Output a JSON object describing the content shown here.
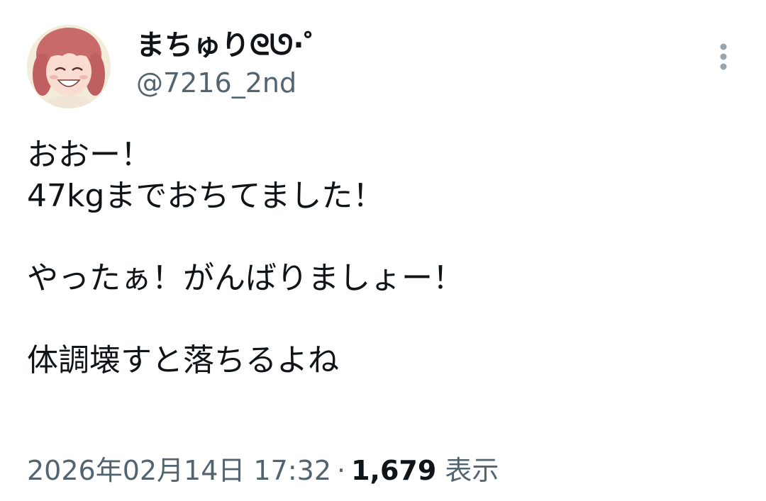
{
  "author": {
    "display_name": "まちゅり",
    "display_name_suffix": "ᘓᘎ·゜",
    "handle": "@7216_2nd",
    "avatar_icon": "user-avatar-anime-portrait"
  },
  "more_icon": "more-options-vertical-dots-icon",
  "body": {
    "lines": [
      "おおー！",
      "47kgまでおちてました！",
      "",
      "やったぁ！がんばりましょー！",
      "",
      "体調壊すと落ちるよね"
    ]
  },
  "meta": {
    "timestamp": "2026年02月14日 17:32",
    "separator": "·",
    "views_count": "1,679",
    "views_label": "表示"
  },
  "colors": {
    "text_primary": "#0f1419",
    "text_secondary": "#536471",
    "background": "#ffffff"
  }
}
